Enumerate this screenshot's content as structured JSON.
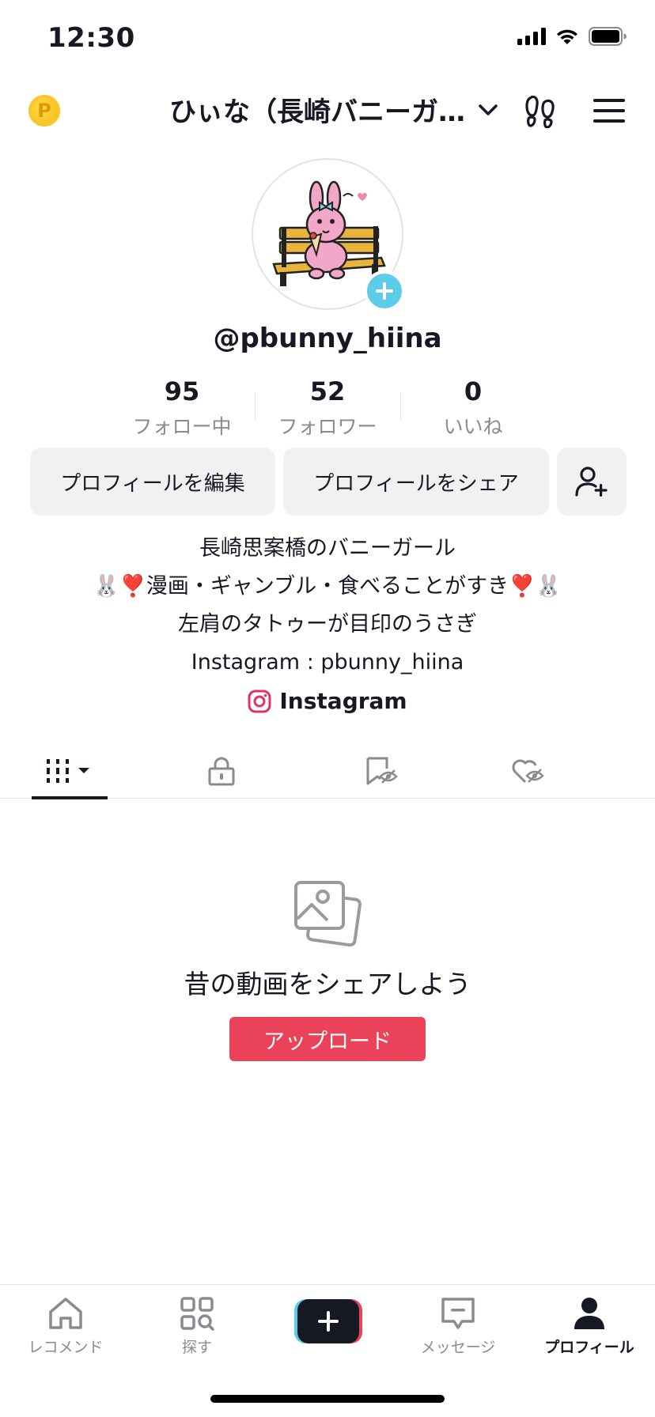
{
  "status_bar": {
    "time": "12:30"
  },
  "header": {
    "account_name": "ひぃな（長崎バニーガ…"
  },
  "profile": {
    "username": "@pbunny_hiina",
    "stats": [
      {
        "value": "95",
        "label": "フォロー中"
      },
      {
        "value": "52",
        "label": "フォロワー"
      },
      {
        "value": "0",
        "label": "いいね"
      }
    ],
    "edit_label": "プロフィールを編集",
    "share_label": "プロフィールをシェア",
    "bio": [
      "長崎思案橋のバニーガール",
      "🐰❣️漫画・ギャンブル・食べることがすき❣️🐰",
      "左肩のタトゥーが目印のうさぎ",
      "Instagram : pbunny_hiina"
    ],
    "link_label": "Instagram"
  },
  "empty_state": {
    "title": "昔の動画をシェアしよう",
    "upload_label": "アップロード"
  },
  "bottom_nav": [
    {
      "label": "レコメンド"
    },
    {
      "label": "探す"
    },
    {
      "label": "メッセージ"
    },
    {
      "label": "プロフィール"
    }
  ],
  "colors": {
    "accent": "#ea4359",
    "avatar_plus": "#5ccce8",
    "coin": "#f2b80d"
  }
}
